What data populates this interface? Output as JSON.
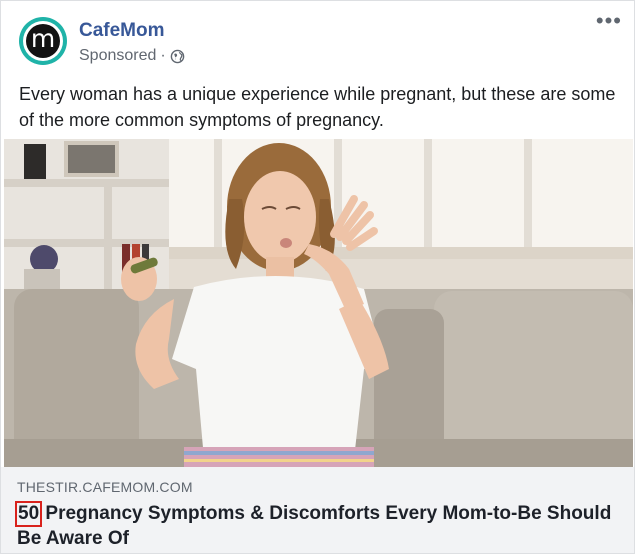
{
  "post": {
    "page_name": "CafeMom",
    "avatar_letter": "m",
    "sponsored_label": "Sponsored",
    "separator": "·",
    "privacy_icon": "globe-icon",
    "more_icon": "more-options-icon",
    "more_glyph": "•••",
    "caption": "Every woman has a unique experience while pregnant, but these are some of the more common symptoms of pregnancy."
  },
  "link": {
    "domain": "THESTIR.CAFEMOM.COM",
    "headline_number": "50",
    "headline_rest": "Pregnancy Symptoms & Discomforts Every Mom-to-Be Should Be Aware Of"
  },
  "colors": {
    "brand_teal": "#1fb3a8",
    "page_name_blue": "#385898",
    "highlight_red": "#d9221c",
    "link_bg": "#f2f3f5"
  }
}
